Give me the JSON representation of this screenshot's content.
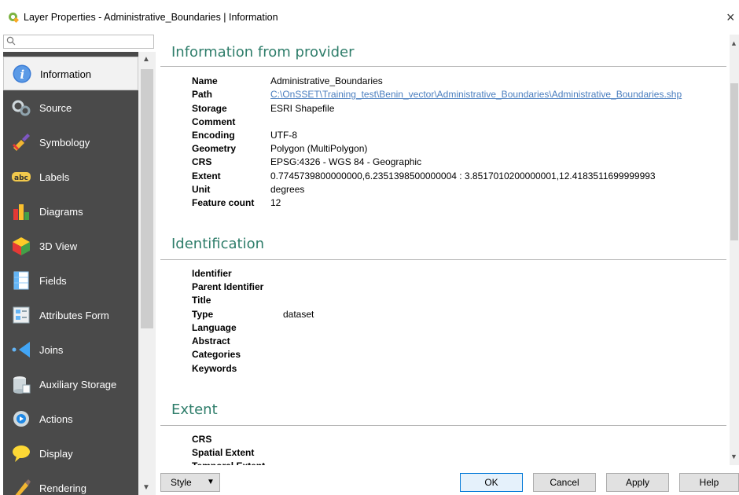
{
  "window": {
    "title": "Layer Properties - Administrative_Boundaries | Information",
    "close_glyph": "×"
  },
  "search": {
    "placeholder": ""
  },
  "sidebar": {
    "items": [
      {
        "label": "Information",
        "icon": "info-icon",
        "selected": true
      },
      {
        "label": "Source",
        "icon": "source-icon"
      },
      {
        "label": "Symbology",
        "icon": "symbology-icon"
      },
      {
        "label": "Labels",
        "icon": "labels-icon"
      },
      {
        "label": "Diagrams",
        "icon": "diagrams-icon"
      },
      {
        "label": "3D View",
        "icon": "3d-view-icon"
      },
      {
        "label": "Fields",
        "icon": "fields-icon"
      },
      {
        "label": "Attributes Form",
        "icon": "attributes-form-icon"
      },
      {
        "label": "Joins",
        "icon": "joins-icon"
      },
      {
        "label": "Auxiliary Storage",
        "icon": "auxiliary-storage-icon"
      },
      {
        "label": "Actions",
        "icon": "actions-icon"
      },
      {
        "label": "Display",
        "icon": "display-icon"
      },
      {
        "label": "Rendering",
        "icon": "rendering-icon"
      }
    ]
  },
  "provider": {
    "heading": "Information from provider",
    "rows": [
      {
        "key": "Name",
        "value": "Administrative_Boundaries"
      },
      {
        "key": "Path",
        "value": "C:\\OnSSET\\Training_test\\Benin_vector\\Administrative_Boundaries\\Administrative_Boundaries.shp",
        "link": true
      },
      {
        "key": "Storage",
        "value": "ESRI Shapefile"
      },
      {
        "key": "Comment",
        "value": ""
      },
      {
        "key": "Encoding",
        "value": "UTF-8"
      },
      {
        "key": "Geometry",
        "value": "Polygon (MultiPolygon)"
      },
      {
        "key": "CRS",
        "value": "EPSG:4326 - WGS 84 - Geographic"
      },
      {
        "key": "Extent",
        "value": "0.7745739800000000,6.2351398500000004 : 3.8517010200000001,12.4183511699999993"
      },
      {
        "key": "Unit",
        "value": "degrees"
      },
      {
        "key": "Feature count",
        "value": "12"
      }
    ]
  },
  "identification": {
    "heading": "Identification",
    "rows": [
      {
        "key": "Identifier",
        "value": ""
      },
      {
        "key": "Parent Identifier",
        "value": ""
      },
      {
        "key": "Title",
        "value": ""
      },
      {
        "key": "Type",
        "value": "dataset"
      },
      {
        "key": "Language",
        "value": ""
      },
      {
        "key": "Abstract",
        "value": ""
      },
      {
        "key": "Categories",
        "value": ""
      },
      {
        "key": "Keywords",
        "value": ""
      }
    ]
  },
  "extent": {
    "heading": "Extent",
    "rows": [
      {
        "key": "CRS",
        "value": ""
      },
      {
        "key": "Spatial Extent",
        "value": ""
      },
      {
        "key": "Temporal Extent",
        "value": ""
      }
    ]
  },
  "buttons": {
    "style": "Style",
    "ok": "OK",
    "cancel": "Cancel",
    "apply": "Apply",
    "help": "Help"
  },
  "colors": {
    "accent_heading": "#2e7d6a",
    "sidebar_bg": "#4a4a4a",
    "link": "#4a7ebf"
  }
}
